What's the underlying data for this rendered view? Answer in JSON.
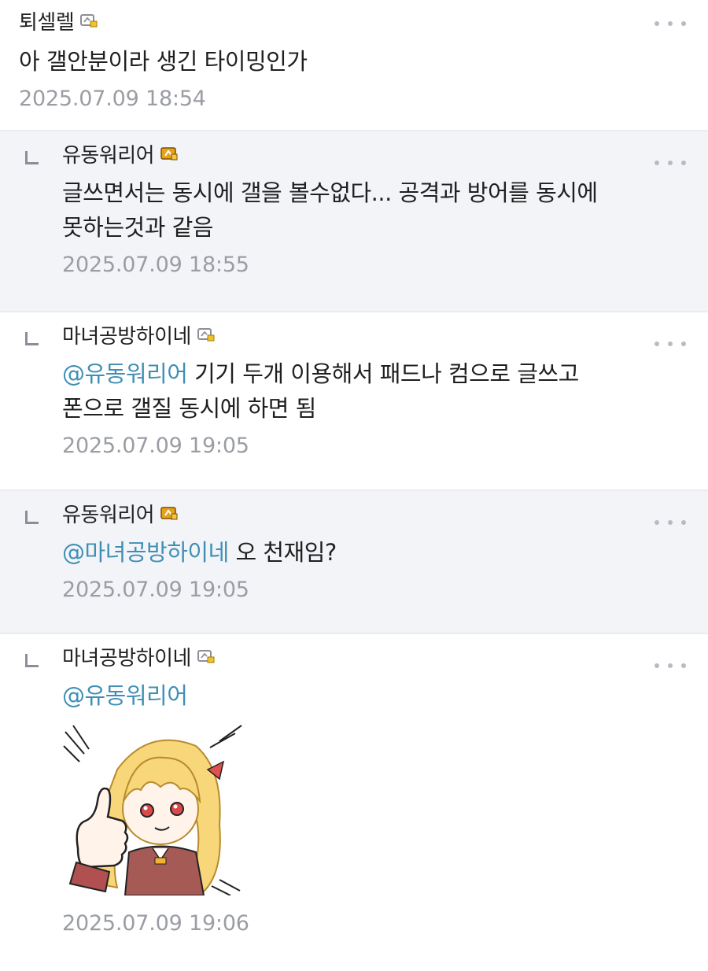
{
  "comments": [
    {
      "nick": "퇴셀렐",
      "badge": "gray",
      "text": "아 갤안분이라 생긴 타이밍인가",
      "time": "2025.07.09 18:54"
    },
    {
      "nick": "유동워리어",
      "badge": "gold",
      "text_line1": "글쓰면서는 동시에 갤을 볼수없다... 공격과 방어를 동시에",
      "text_line2": "못하는것과 같음",
      "time": "2025.07.09 18:55"
    },
    {
      "nick": "마녀공방하이네",
      "badge": "gray",
      "mention": "@유동워리어",
      "text_line1": " 기기 두개 이용해서 패드나 컴으로 글쓰고",
      "text_line2": "폰으로 갤질 동시에 하면 됨",
      "time": "2025.07.09 19:05"
    },
    {
      "nick": "유동워리어",
      "badge": "gold",
      "mention": "@마녀공방하이네",
      "text": " 오 천재임?",
      "time": "2025.07.09 19:05"
    },
    {
      "nick": "마녀공방하이네",
      "badge": "gray",
      "mention": "@유동워리어",
      "sticker": "thumbs-up-anime-girl",
      "time": "2025.07.09 19:06"
    }
  ],
  "colors": {
    "mention": "#3f8fb5",
    "timestamp": "#9a9da3",
    "alt_background": "#f3f4f8",
    "gold_badge": "#e8a21a"
  }
}
